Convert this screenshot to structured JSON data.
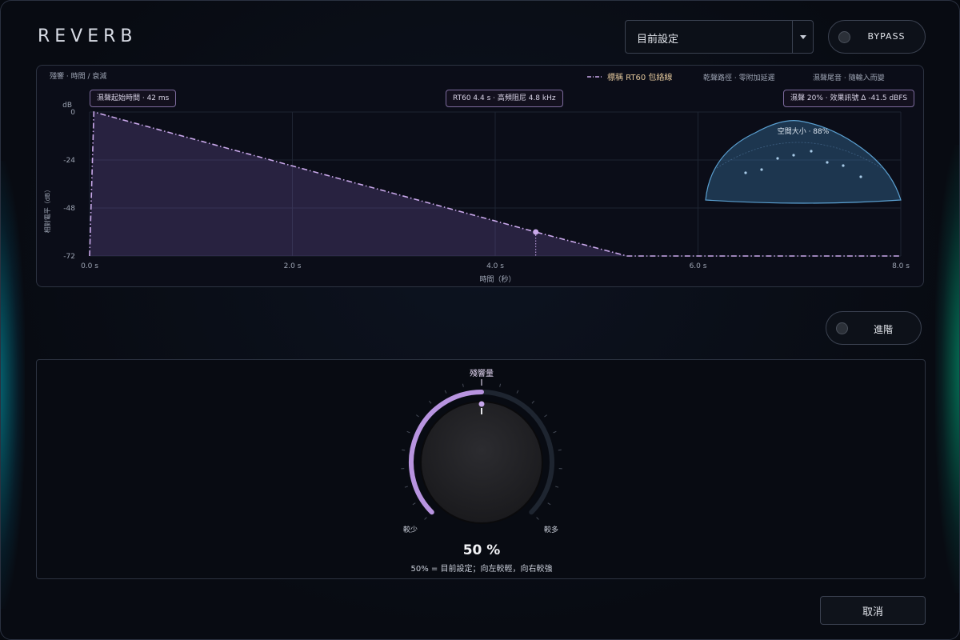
{
  "header": {
    "title": "REVERB"
  },
  "preset": {
    "value": "目前設定"
  },
  "bypass": {
    "label": "BYPASS"
  },
  "advanced": {
    "label": "進階"
  },
  "graph": {
    "header_left": "殘響 · 時間 / 衰減",
    "legend": [
      {
        "label": "標稱 RT60 包絡線",
        "color": "#c9a8ea"
      },
      {
        "label": "乾聲路徑 · 零附加延遲",
        "color": "#8d94a3"
      },
      {
        "label": "濕聲尾音 · 隨輸入而變",
        "color": "#8d94a3"
      }
    ],
    "tags": {
      "predelay": "濕聲起始時間 · 42 ms",
      "rt60": "RT60 4.4 s · 高頻阻尼 4.8 kHz",
      "wet": "濕聲 20% · 效果訊號 Δ -41.5 dBFS"
    },
    "room_label": "空間大小 · 88%",
    "y_unit": "dB",
    "y_axis_label": "相對電平（dB）",
    "x_axis_label": "時間（秒）"
  },
  "chart_data": {
    "type": "line",
    "x": [
      0.0,
      0.042,
      4.4,
      5.3,
      8.0
    ],
    "y": [
      -72,
      0,
      -60,
      -72,
      -72
    ],
    "marker": {
      "x": 4.4,
      "y": -60
    },
    "x_ticks": [
      "0.0 s",
      "2.0 s",
      "4.0 s",
      "6.0 s",
      "8.0 s"
    ],
    "y_ticks": [
      "0",
      "-24",
      "-48",
      "-72"
    ],
    "xlim": [
      0,
      8
    ],
    "ylim": [
      -72,
      0
    ],
    "grid": true,
    "legend_position": "top-right"
  },
  "knob": {
    "label": "殘響量",
    "min_label": "較少",
    "max_label": "較多",
    "value_text": "50 %",
    "value": 0.5,
    "hint": "50% = 目前設定；向左較輕，向右較強"
  },
  "footer": {
    "cancel_label": "取消"
  },
  "colors": {
    "accent": "#b894e0",
    "room": "#5a9fd0"
  }
}
